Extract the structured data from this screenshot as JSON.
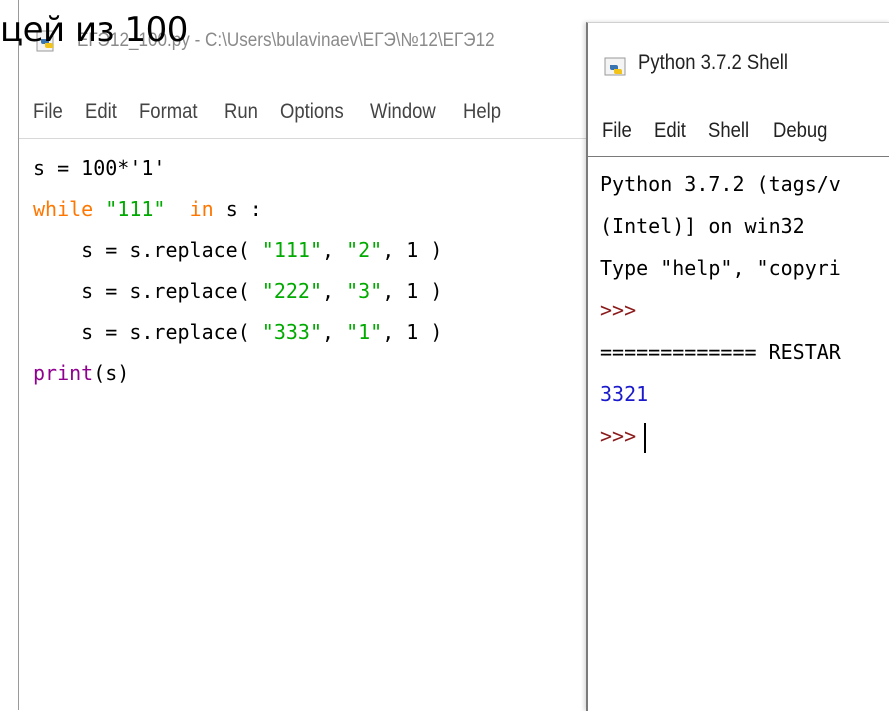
{
  "slide": {
    "text": "цей из 100"
  },
  "editor": {
    "title": "ЕГЭ12_100.py - C:\\Users\\bulavinaev\\ЕГЭ\\№12\\ЕГЭ12",
    "menu": [
      "File",
      "Edit",
      "Format",
      "Run",
      "Options",
      "Window",
      "Help"
    ],
    "code": {
      "line1": "s = 100*'1'",
      "line2_kw": "while",
      "line2_str": "\"111\"",
      "line2_kw2": "in",
      "line2_rest": " s :",
      "lines_replace": [
        {
          "prefix": "    s = s.replace( ",
          "a": "\"111\"",
          "sep": ", ",
          "b": "\"2\"",
          "suffix": ", 1 )"
        },
        {
          "prefix": "    s = s.replace( ",
          "a": "\"222\"",
          "sep": ", ",
          "b": "\"3\"",
          "suffix": ", 1 )"
        },
        {
          "prefix": "    s = s.replace( ",
          "a": "\"333\"",
          "sep": ", ",
          "b": "\"1\"",
          "suffix": ", 1 )"
        }
      ],
      "print_fn": "print",
      "print_args": "(s)"
    }
  },
  "shell": {
    "title": "Python 3.7.2 Shell",
    "menu": [
      "File",
      "Edit",
      "Shell",
      "Debug"
    ],
    "lines": {
      "l1": "Python 3.7.2 (tags/v",
      "l2": "(Intel)] on win32",
      "l3": "Type \"help\", \"copyri",
      "prompt1": ">>>",
      "restart": "============= RESTAR",
      "result": "3321",
      "prompt2": ">>>"
    }
  },
  "colors": {
    "keyword": "#ff7700",
    "string": "#00aa00",
    "builtin": "#900090",
    "result": "#1a1acc",
    "prompt": "#8b1a1a"
  }
}
